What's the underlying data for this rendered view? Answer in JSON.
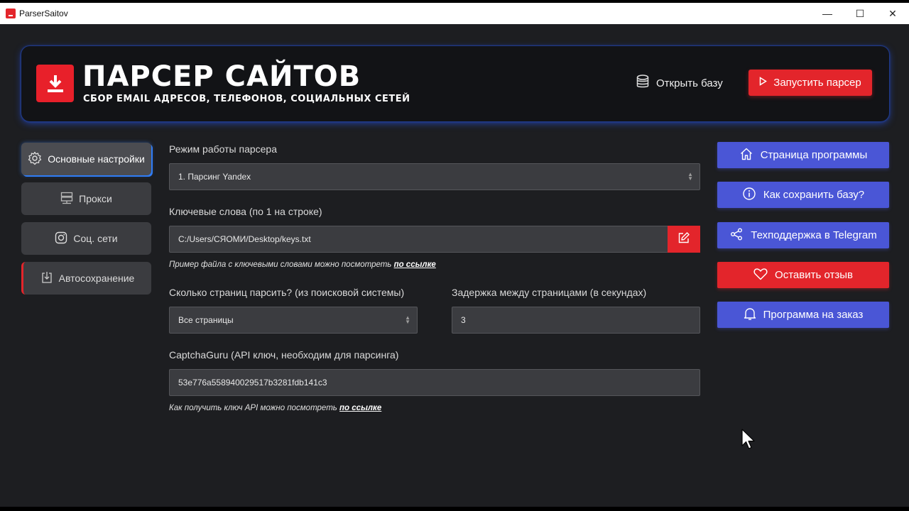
{
  "window": {
    "title": "ParserSaitov",
    "minimize": "—",
    "maximize": "☐",
    "close": "✕"
  },
  "header": {
    "title": "ПАРСЕР САЙТОВ",
    "subtitle": "СБОР EMAIL АДРЕСОВ, ТЕЛЕФОНОВ, СОЦИАЛЬНЫХ СЕТЕЙ",
    "open_db": "Открыть базу",
    "run_parser": "Запустить парсер"
  },
  "sidebar": {
    "items": [
      {
        "label": "Основные настройки",
        "icon": "gear-icon",
        "active": true
      },
      {
        "label": "Прокси",
        "icon": "server-icon"
      },
      {
        "label": "Соц. сети",
        "icon": "instagram-icon"
      },
      {
        "label": "Автосохранение",
        "icon": "save-icon"
      }
    ]
  },
  "form": {
    "mode_label": "Режим работы парсера",
    "mode_value": "1. Парсинг Yandex",
    "keywords_label": "Ключевые слова (по 1 на строке)",
    "keywords_value": "C:/Users/СЯОМИ/Desktop/keys.txt",
    "keywords_hint": "Пример файла с ключевыми словами можно посмотреть ",
    "keywords_hint_link": "по ссылке",
    "pages_label": "Сколько страниц парсить? (из поисковой системы)",
    "pages_value": "Все страницы",
    "delay_label": "Задержка между страницами (в секундах)",
    "delay_value": "3",
    "captcha_label": "CaptchaGuru (API ключ, необходим для парсинга)",
    "captcha_value": "53e776a558940029517b3281fdb141c3",
    "captcha_hint": "Как получить ключ API можно посмотреть ",
    "captcha_hint_link": "по ссылке"
  },
  "right_panel": {
    "buttons": [
      {
        "label": "Страница программы",
        "icon": "home-icon",
        "color": "#4a56d6"
      },
      {
        "label": "Как сохранить базу?",
        "icon": "info-icon",
        "color": "#4a56d6"
      },
      {
        "label": "Техподдержка в Telegram",
        "icon": "share-icon",
        "color": "#4a56d6"
      },
      {
        "label": "Оставить отзыв",
        "icon": "heart-icon",
        "color": "#e3252b"
      },
      {
        "label": "Программа на заказ",
        "icon": "bell-icon",
        "color": "#4a56d6"
      }
    ]
  },
  "colors": {
    "accent_red": "#e3252b",
    "accent_blue": "#4a56d6",
    "glow_blue": "#2f7cf6",
    "background": "#1d1e21"
  }
}
